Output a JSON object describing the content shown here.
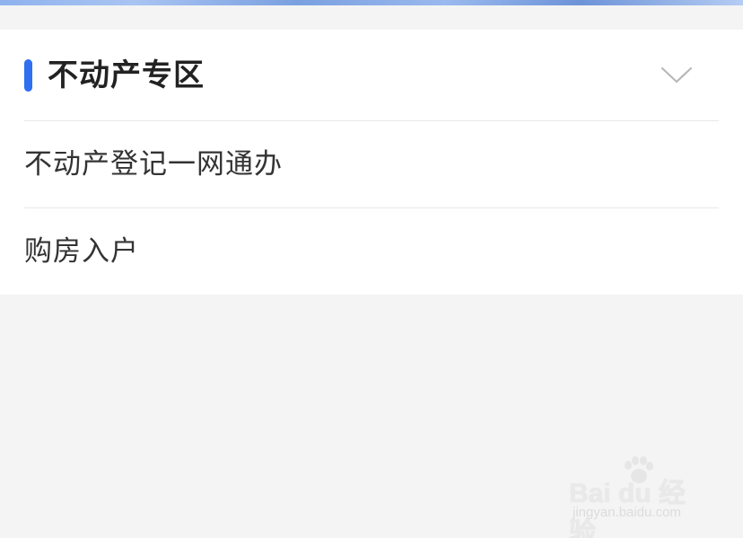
{
  "section": {
    "title": "不动产专区",
    "accent_color": "#2f6ff0",
    "toggle_icon": "chevron-down-icon"
  },
  "menu": {
    "items": [
      {
        "label": "不动产登记一网通办"
      },
      {
        "label": "购房入户"
      }
    ]
  },
  "watermark": {
    "logo_text": "Bai du 经验",
    "url_text": "jingyan.baidu.com"
  }
}
